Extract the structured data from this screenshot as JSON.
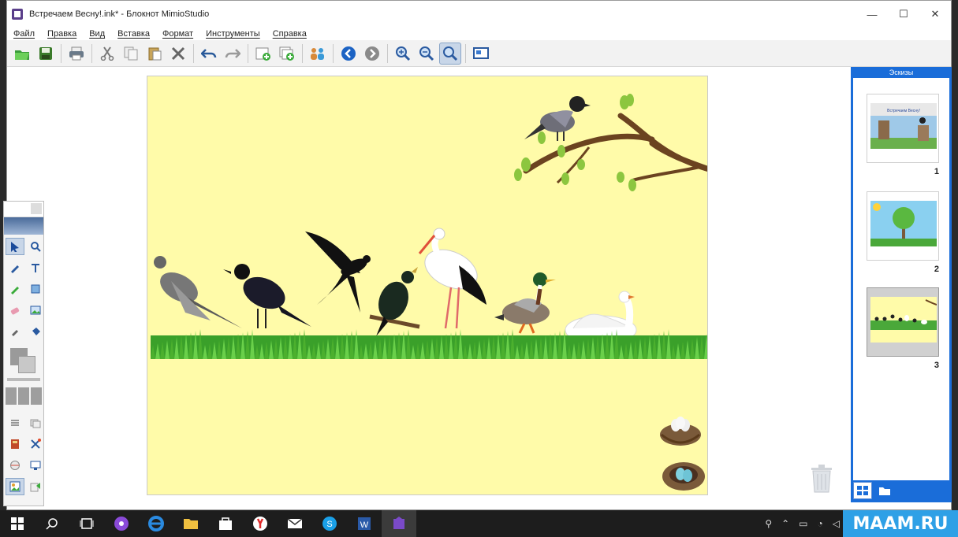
{
  "window": {
    "title": "Встречаем Весну!.ink* - Блокнот MimioStudio",
    "controls": {
      "minimize": "—",
      "maximize": "☐",
      "close": "✕"
    }
  },
  "menu": [
    "Файл",
    "Правка",
    "Вид",
    "Вставка",
    "Формат",
    "Инструменты",
    "Справка"
  ],
  "toolbar": {
    "icons": [
      "open-icon",
      "save-icon",
      "print-icon",
      "cut-icon",
      "copy-icon",
      "paste-icon",
      "delete-icon",
      "undo-icon",
      "redo-icon",
      "add-page-icon",
      "duplicate-page-icon",
      "people-icon",
      "back-icon",
      "forward-icon",
      "zoom-in-icon",
      "zoom-out-icon",
      "zoom-fit-icon",
      "screen-icon"
    ],
    "active_index": 16
  },
  "sidebar": {
    "title": "Эскизы",
    "thumbnails": [
      {
        "number": "1",
        "caption": "Встречаем Весну!"
      },
      {
        "number": "2"
      },
      {
        "number": "3",
        "selected": true
      }
    ]
  },
  "taskbar": {
    "apps": [
      "start-icon",
      "search-icon",
      "task-view-icon",
      "alice-icon",
      "edge-icon",
      "explorer-icon",
      "store-icon",
      "yandex-icon",
      "mail-icon",
      "skype-icon",
      "word-icon",
      "mimio-icon"
    ],
    "active_index": 11
  },
  "watermark": "MAAM.RU",
  "colors": {
    "slide_background": "#fffba9",
    "sidebar_blue": "#1a6dd9",
    "taskbar": "#1d1d1d"
  }
}
